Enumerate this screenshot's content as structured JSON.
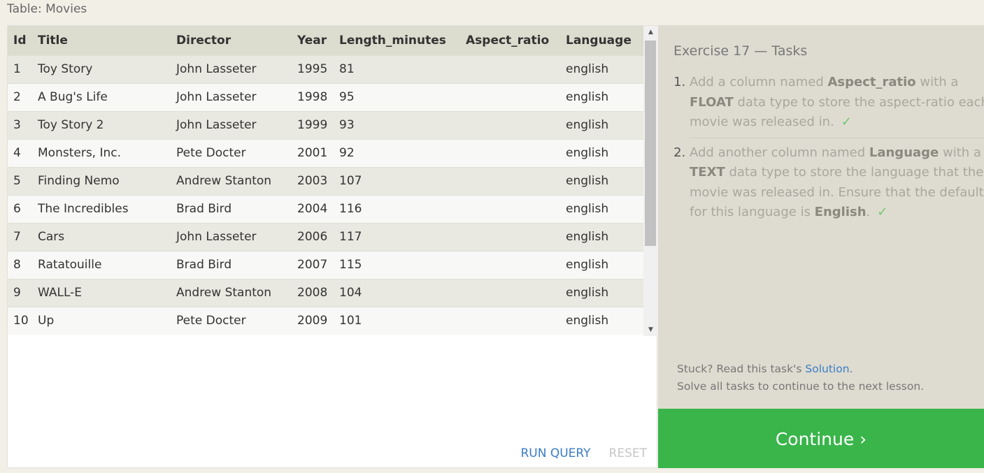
{
  "table_caption": "Table: Movies",
  "columns": [
    "Id",
    "Title",
    "Director",
    "Year",
    "Length_minutes",
    "Aspect_ratio",
    "Language"
  ],
  "rows": [
    [
      "1",
      "Toy Story",
      "John Lasseter",
      "1995",
      "81",
      "",
      "english"
    ],
    [
      "2",
      "A Bug's Life",
      "John Lasseter",
      "1998",
      "95",
      "",
      "english"
    ],
    [
      "3",
      "Toy Story 2",
      "John Lasseter",
      "1999",
      "93",
      "",
      "english"
    ],
    [
      "4",
      "Monsters, Inc.",
      "Pete Docter",
      "2001",
      "92",
      "",
      "english"
    ],
    [
      "5",
      "Finding Nemo",
      "Andrew Stanton",
      "2003",
      "107",
      "",
      "english"
    ],
    [
      "6",
      "The Incredibles",
      "Brad Bird",
      "2004",
      "116",
      "",
      "english"
    ],
    [
      "7",
      "Cars",
      "John Lasseter",
      "2006",
      "117",
      "",
      "english"
    ],
    [
      "8",
      "Ratatouille",
      "Brad Bird",
      "2007",
      "115",
      "",
      "english"
    ],
    [
      "9",
      "WALL-E",
      "Andrew Stanton",
      "2008",
      "104",
      "",
      "english"
    ],
    [
      "10",
      "Up",
      "Pete Docter",
      "2009",
      "101",
      "",
      "english"
    ]
  ],
  "scrollbar": {
    "up_icon": "▲",
    "down_icon": "▼"
  },
  "actions": {
    "run_query": "RUN QUERY",
    "reset": "RESET"
  },
  "tasks": {
    "heading": "Exercise 17 — Tasks",
    "items": [
      {
        "parts": [
          {
            "text": "Add a column named ",
            "bold": false
          },
          {
            "text": "Aspect_ratio",
            "bold": true
          },
          {
            "text": " with a ",
            "bold": false
          },
          {
            "text": "FLOAT",
            "bold": true
          },
          {
            "text": " data type to store the aspect-ratio each movie was released in.",
            "bold": false
          }
        ],
        "check": "✓"
      },
      {
        "parts": [
          {
            "text": "Add another column named ",
            "bold": false
          },
          {
            "text": "Language",
            "bold": true
          },
          {
            "text": " with a ",
            "bold": false
          },
          {
            "text": "TEXT",
            "bold": true
          },
          {
            "text": " data type to store the language that the movie was released in. Ensure that the default for this language is ",
            "bold": false
          },
          {
            "text": "English",
            "bold": true
          },
          {
            "text": ".",
            "bold": false
          }
        ],
        "check": "✓"
      }
    ],
    "stuck_prefix": "Stuck? Read this task's ",
    "solution_link": "Solution",
    "stuck_suffix": ".",
    "next_lesson_note": "Solve all tasks to continue to the next lesson."
  },
  "continue_label": "Continue ›",
  "colors": {
    "continue": "#39b54a",
    "link": "#3a7cc7",
    "check": "#6fc56f"
  }
}
